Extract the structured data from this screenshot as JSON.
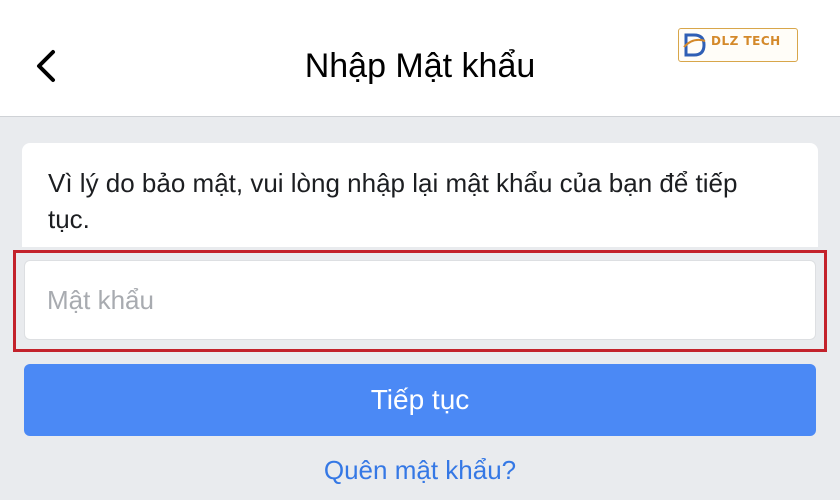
{
  "header": {
    "title": "Nhập Mật khẩu",
    "back_icon": "chevron-left-icon",
    "logo_text": "DLZ TECH"
  },
  "content": {
    "message": "Vì lý do bảo mật, vui lòng nhập lại mật khẩu của bạn để tiếp tục.",
    "password": {
      "value": "",
      "placeholder": "Mật khẩu"
    },
    "continue_label": "Tiếp tục",
    "forgot_label": "Quên mật khẩu?"
  },
  "colors": {
    "primary_button": "#4b89f5",
    "link": "#3578e5",
    "highlight": "#c3222b",
    "logo_accent": "#d4892a"
  }
}
